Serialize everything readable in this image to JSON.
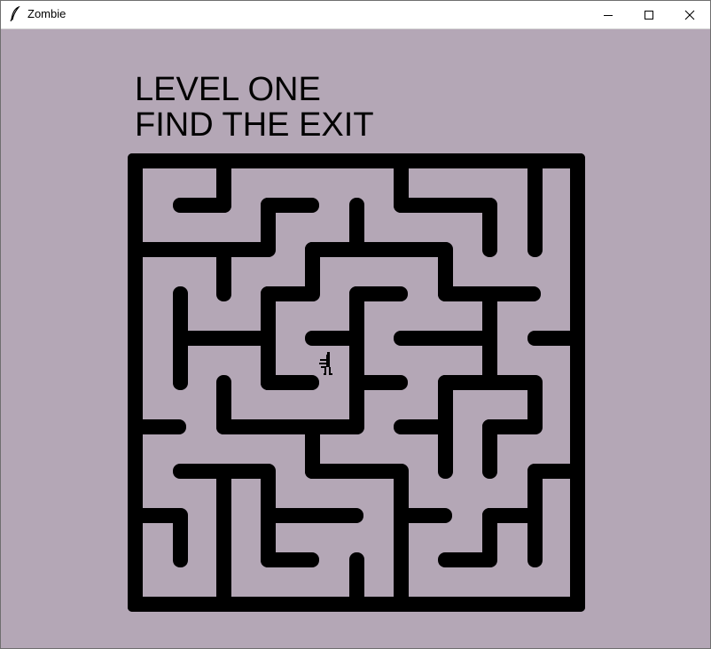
{
  "window": {
    "title": "Zombie",
    "app_icon": "feather-icon",
    "controls": [
      "minimize-icon",
      "maximize-icon",
      "close-icon"
    ]
  },
  "game": {
    "heading_line1": "LEVEL ONE",
    "heading_line2": "FIND THE EXIT",
    "background_color": "#b4a7b6",
    "wall_color": "#000000",
    "player": "stick-figure-player"
  }
}
